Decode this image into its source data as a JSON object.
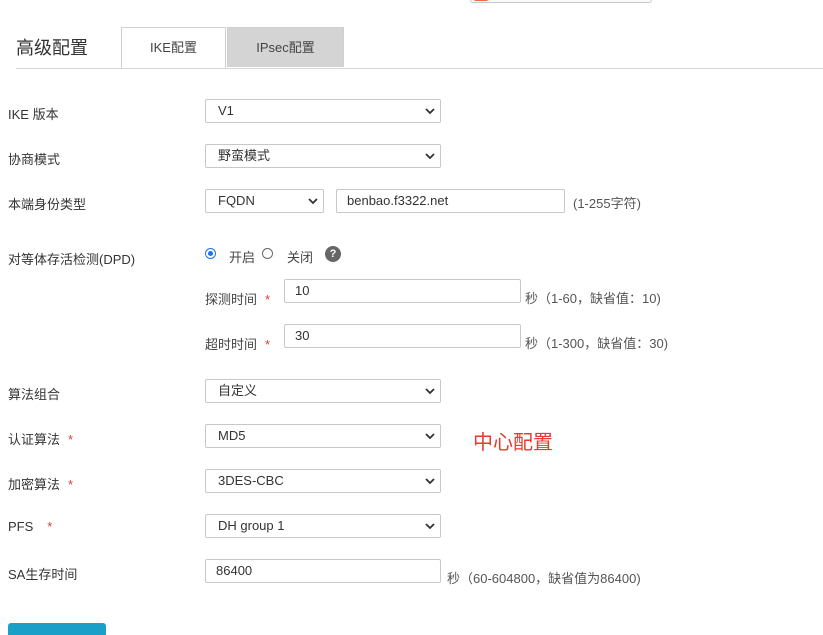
{
  "page": {
    "title": "高级配置"
  },
  "tabs": [
    {
      "label": "IKE配置"
    },
    {
      "label": "IPsec配置"
    }
  ],
  "form": {
    "ike_version": {
      "label": "IKE 版本",
      "value": "V1"
    },
    "negotiation_mode": {
      "label": "协商模式",
      "value": "野蛮模式"
    },
    "local_id_type": {
      "label": "本端身份类型",
      "value": "FQDN",
      "input_value": "benbao.f3322.net",
      "hint": "(1-255字符)"
    },
    "dpd": {
      "label": "对等体存活检测(DPD)",
      "option_on": "开启",
      "option_off": "关闭",
      "selected": "开启",
      "help": "?",
      "interval": {
        "label": "探测时间",
        "value": "10",
        "hint": "秒（1-60，缺省值：10)"
      },
      "timeout": {
        "label": "超时时间",
        "value": "30",
        "hint": "秒（1-300，缺省值：30)"
      }
    },
    "algorithm_suite": {
      "label": "算法组合",
      "value": "自定义"
    },
    "auth_algorithm": {
      "label": "认证算法",
      "value": "MD5"
    },
    "encryption_algorithm": {
      "label": "加密算法",
      "value": "3DES-CBC"
    },
    "pfs": {
      "label": "PFS",
      "value": "DH group 1"
    },
    "sa_lifetime": {
      "label": "SA生存时间",
      "value": "86400",
      "hint": "秒（60-604800，缺省值为86400)"
    },
    "required_mark": "*"
  },
  "annotation": {
    "text": "中心配置",
    "color": "#e8392e"
  },
  "colors": {
    "accent": "#1a73e8",
    "required": "#e03c31",
    "button": "#1aa0c8"
  },
  "icons": {
    "select_arrow": "chevron-down-icon",
    "help": "question-circle-icon"
  }
}
